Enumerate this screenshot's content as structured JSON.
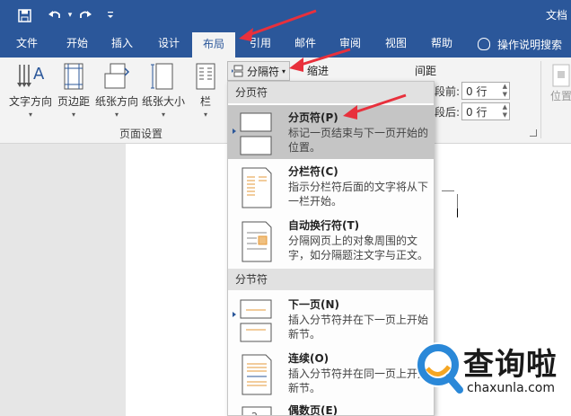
{
  "title_bar": {
    "doc_title": "文档",
    "save_icon": "save-icon",
    "undo_icon": "undo-icon",
    "redo_icon": "redo-icon",
    "customize_icon": "customize-qat-icon"
  },
  "tabs": [
    {
      "label": "文件"
    },
    {
      "label": "开始"
    },
    {
      "label": "插入"
    },
    {
      "label": "设计"
    },
    {
      "label": "布局",
      "active": true
    },
    {
      "label": "引用"
    },
    {
      "label": "邮件"
    },
    {
      "label": "审阅"
    },
    {
      "label": "视图"
    },
    {
      "label": "帮助"
    }
  ],
  "tell_me": "操作说明搜索",
  "ribbon": {
    "text_direction": "文字方向",
    "margins": "页边距",
    "orientation": "纸张方向",
    "size": "纸张大小",
    "columns": "栏",
    "page_setup_label": "页面设置",
    "breaks_button": "分隔符",
    "indent_label": "缩进",
    "spacing_label": "间距",
    "before_label": "段前:",
    "before_value": "0 行",
    "after_label": "段后:",
    "after_value": "0 行",
    "position_label": "位置"
  },
  "dropdown": {
    "section_page": "分页符",
    "section_section": "分节符",
    "items": [
      {
        "title": "分页符(P)",
        "desc": "标记一页结束与下一页开始的位置。"
      },
      {
        "title": "分栏符(C)",
        "desc": "指示分栏符后面的文字将从下一栏开始。"
      },
      {
        "title": "自动换行符(T)",
        "desc": "分隔网页上的对象周围的文字，如分隔题注文字与正文。"
      },
      {
        "title": "下一页(N)",
        "desc": "插入分节符并在下一页上开始新节。"
      },
      {
        "title": "连续(O)",
        "desc": "插入分节符并在同一页上开始新节。"
      },
      {
        "title": "偶数页(E)",
        "desc": ""
      }
    ]
  },
  "watermark": {
    "text": "查询啦",
    "url": "chaxunla.com"
  },
  "colors": {
    "word_blue": "#2b579a",
    "annotation_red": "#e8303c",
    "highlight": "#c5c5c5"
  }
}
